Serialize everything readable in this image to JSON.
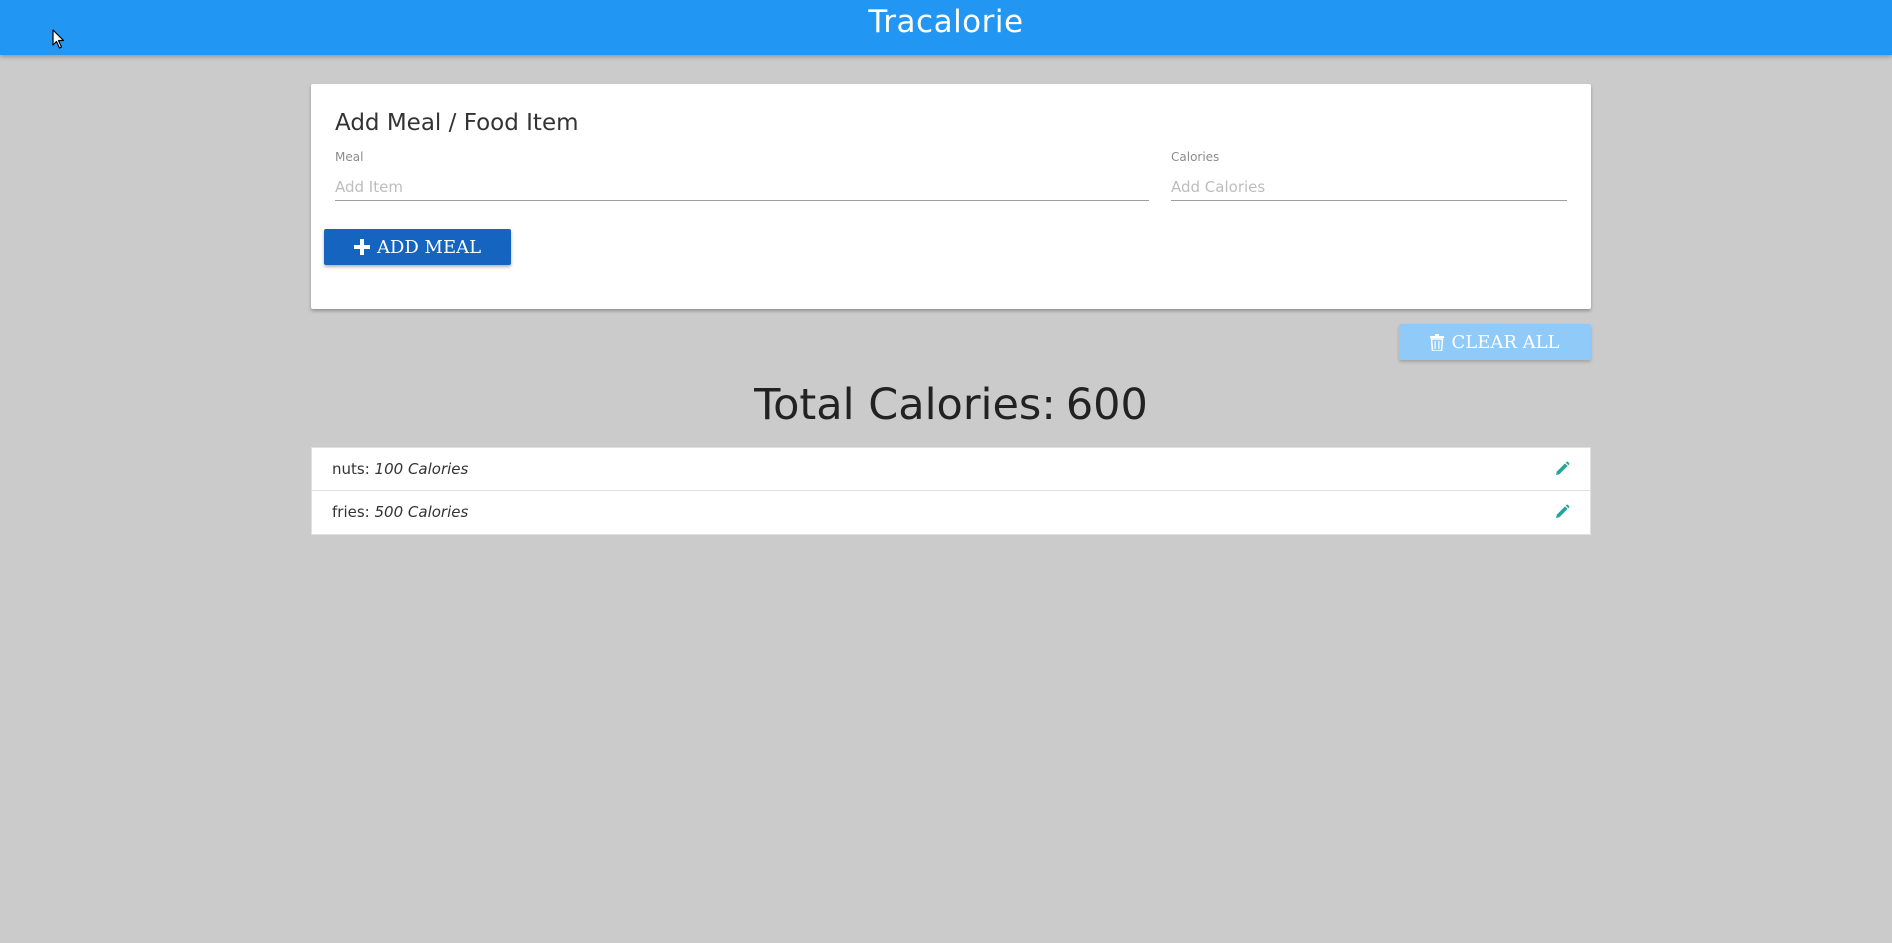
{
  "navbar": {
    "brand": "Tracalorie"
  },
  "form": {
    "title": "Add Meal / Food Item",
    "meal_label": "Meal",
    "meal_placeholder": "Add Item",
    "meal_value": "",
    "calories_label": "Calories",
    "calories_placeholder": "Add Calories",
    "calories_value": "",
    "add_button_label": "ADD MEAL",
    "add_button_icon": "plus-icon"
  },
  "clear_button": {
    "label": "CLEAR ALL",
    "icon": "trash-icon"
  },
  "total": {
    "label": "Total Calories:",
    "value": "600"
  },
  "items": [
    {
      "name": "nuts:",
      "calories": "100 Calories",
      "edit_icon": "pencil-icon"
    },
    {
      "name": "fries:",
      "calories": "500 Calories",
      "edit_icon": "pencil-icon"
    }
  ],
  "colors": {
    "navbar": "#2196f3",
    "add_button": "#1565c0",
    "clear_button": "#90caf9",
    "edit_icon": "#26a69a",
    "background": "#cbcbcb"
  }
}
